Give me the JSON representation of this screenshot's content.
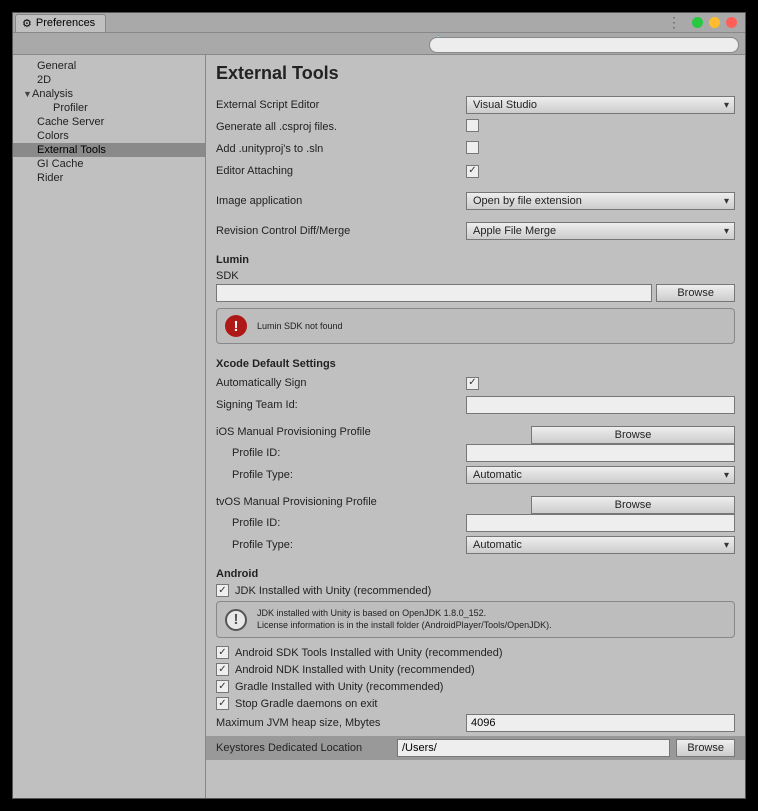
{
  "tab_title": "Preferences",
  "sidebar": {
    "items": [
      {
        "label": "General"
      },
      {
        "label": "2D"
      },
      {
        "label": "Analysis",
        "expandable": true
      },
      {
        "label": "Profiler",
        "level": 2
      },
      {
        "label": "Cache Server"
      },
      {
        "label": "Colors"
      },
      {
        "label": "External Tools",
        "selected": true
      },
      {
        "label": "GI Cache"
      },
      {
        "label": "Rider"
      }
    ]
  },
  "main": {
    "title": "External Tools",
    "ext_script_editor_label": "External Script Editor",
    "ext_script_editor_value": "Visual Studio",
    "gen_csproj_label": "Generate all .csproj files.",
    "add_unityproj_label": "Add .unityproj's to .sln",
    "editor_attaching_label": "Editor Attaching",
    "image_app_label": "Image application",
    "image_app_value": "Open by file extension",
    "rev_control_label": "Revision Control Diff/Merge",
    "rev_control_value": "Apple File Merge",
    "lumin_head": "Lumin",
    "sdk_label": "SDK",
    "browse_label": "Browse",
    "lumin_warn": "Lumin SDK not found",
    "xcode_head": "Xcode Default Settings",
    "auto_sign_label": "Automatically Sign",
    "signing_team_label": "Signing Team Id:",
    "ios_prov_label": "iOS Manual Provisioning Profile",
    "profile_id_label": "Profile ID:",
    "profile_type_label": "Profile Type:",
    "profile_type_value": "Automatic",
    "tvos_prov_label": "tvOS Manual Provisioning Profile",
    "android_head": "Android",
    "jdk_label": "JDK Installed with Unity (recommended)",
    "jdk_info_1": "JDK installed with Unity is based on OpenJDK 1.8.0_152.",
    "jdk_info_2": "License information is in the install folder (AndroidPlayer/Tools/OpenJDK).",
    "android_sdk_label": "Android SDK Tools Installed with Unity (recommended)",
    "android_ndk_label": "Android NDK Installed with Unity (recommended)",
    "gradle_label": "Gradle Installed with Unity (recommended)",
    "stop_gradle_label": "Stop Gradle daemons on exit",
    "max_jvm_label": "Maximum JVM heap size, Mbytes",
    "max_jvm_value": "4096",
    "keystores_label": "Keystores Dedicated Location",
    "keystores_value": "/Users/"
  }
}
